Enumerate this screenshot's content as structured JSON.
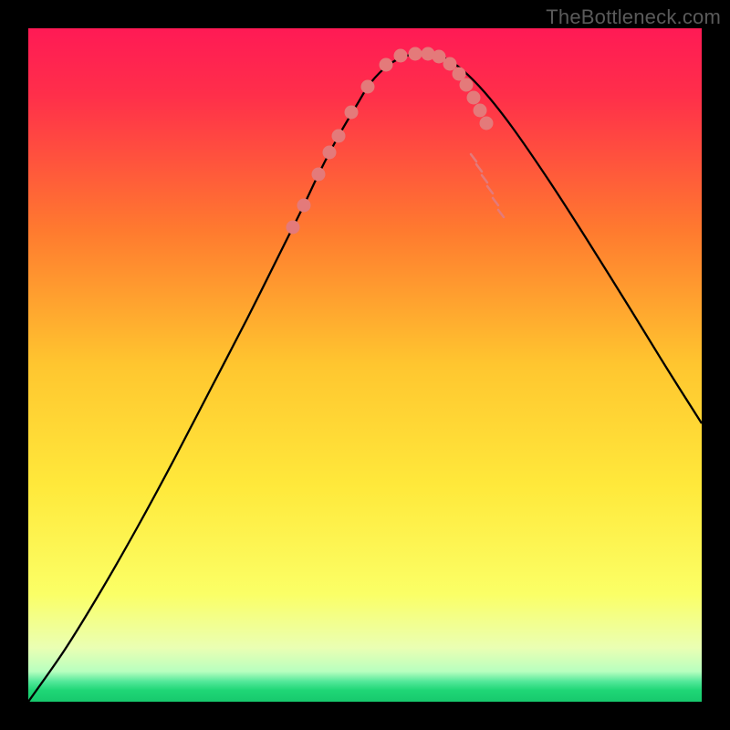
{
  "watermark": "TheBottleneck.com",
  "colors": {
    "bg_black": "#000000",
    "grad_top": "#ff1a4d",
    "grad_mid1": "#ffb02e",
    "grad_mid2": "#ffe93b",
    "grad_bottom_yellow": "#fbff66",
    "grad_green": "#21e07b",
    "line_black": "#000000",
    "marker": "#e47a7a",
    "tick": "#e47a7a",
    "watermark": "#5a5a5a"
  },
  "chart_data": {
    "type": "line",
    "title": "",
    "xlabel": "",
    "ylabel": "",
    "xlim": [
      0,
      738
    ],
    "ylim": [
      0,
      738
    ],
    "curve": {
      "name": "bottleneck-curve",
      "x": [
        0,
        40,
        80,
        120,
        160,
        200,
        240,
        280,
        300,
        320,
        340,
        360,
        375,
        395,
        415,
        435,
        455,
        475,
        500,
        530,
        570,
        610,
        660,
        700,
        738
      ],
      "y": [
        0,
        57,
        122,
        192,
        266,
        343,
        420,
        500,
        540,
        582,
        620,
        654,
        678,
        698,
        708,
        710,
        706,
        693,
        668,
        630,
        572,
        510,
        430,
        365,
        305
      ]
    },
    "markers": {
      "name": "points",
      "x": [
        290,
        302,
        318,
        330,
        340,
        354,
        372,
        392,
        408,
        424,
        438,
        450,
        462,
        472,
        480,
        488,
        495,
        502
      ],
      "y": [
        520,
        544,
        578,
        602,
        620,
        646,
        674,
        698,
        708,
        710,
        710,
        707,
        699,
        688,
        676,
        662,
        648,
        634
      ]
    },
    "ticks_right": {
      "x": [
        488,
        494,
        500,
        506,
        512,
        518
      ],
      "y": [
        596,
        585,
        573,
        561,
        548,
        535
      ]
    }
  }
}
